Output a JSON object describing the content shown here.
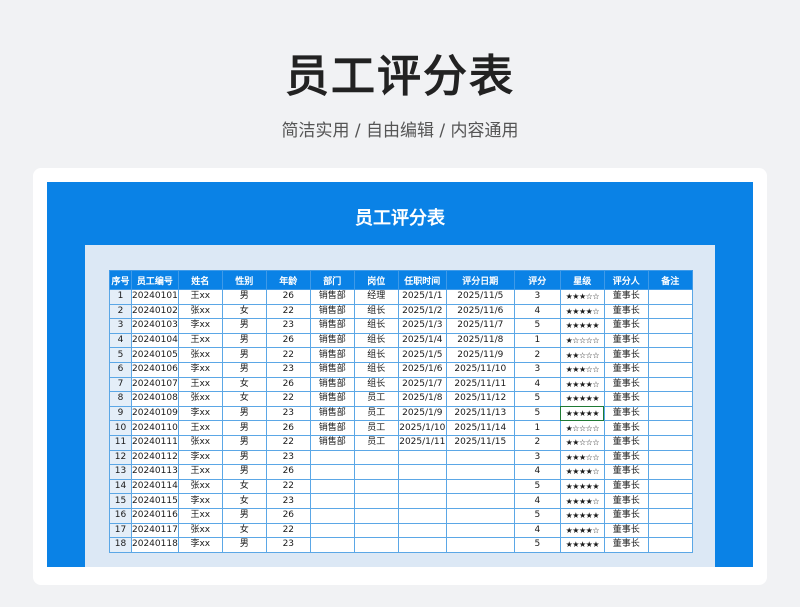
{
  "page": {
    "title": "员工评分表",
    "subtitle": "简洁实用 / 自由编辑 / 内容通用"
  },
  "sheet": {
    "title": "员工评分表",
    "columns": [
      "序号",
      "员工编号",
      "姓名",
      "性别",
      "年龄",
      "部门",
      "岗位",
      "任职时间",
      "评分日期",
      "评分",
      "星级",
      "评分人",
      "备注"
    ],
    "rows": [
      [
        "1",
        "20240101",
        "王xx",
        "男",
        "26",
        "销售部",
        "经理",
        "2025/1/1",
        "2025/11/5",
        "3",
        "★★★☆☆",
        "董事长",
        ""
      ],
      [
        "2",
        "20240102",
        "张xx",
        "女",
        "22",
        "销售部",
        "组长",
        "2025/1/2",
        "2025/11/6",
        "4",
        "★★★★☆",
        "董事长",
        ""
      ],
      [
        "3",
        "20240103",
        "李xx",
        "男",
        "23",
        "销售部",
        "组长",
        "2025/1/3",
        "2025/11/7",
        "5",
        "★★★★★",
        "董事长",
        ""
      ],
      [
        "4",
        "20240104",
        "王xx",
        "男",
        "26",
        "销售部",
        "组长",
        "2025/1/4",
        "2025/11/8",
        "1",
        "★☆☆☆☆",
        "董事长",
        ""
      ],
      [
        "5",
        "20240105",
        "张xx",
        "男",
        "22",
        "销售部",
        "组长",
        "2025/1/5",
        "2025/11/9",
        "2",
        "★★☆☆☆",
        "董事长",
        ""
      ],
      [
        "6",
        "20240106",
        "李xx",
        "男",
        "23",
        "销售部",
        "组长",
        "2025/1/6",
        "2025/11/10",
        "3",
        "★★★☆☆",
        "董事长",
        ""
      ],
      [
        "7",
        "20240107",
        "王xx",
        "女",
        "26",
        "销售部",
        "组长",
        "2025/1/7",
        "2025/11/11",
        "4",
        "★★★★☆",
        "董事长",
        ""
      ],
      [
        "8",
        "20240108",
        "张xx",
        "女",
        "22",
        "销售部",
        "员工",
        "2025/1/8",
        "2025/11/12",
        "5",
        "★★★★★",
        "董事长",
        ""
      ],
      [
        "9",
        "20240109",
        "李xx",
        "男",
        "23",
        "销售部",
        "员工",
        "2025/1/9",
        "2025/11/13",
        "5",
        "★★★★★",
        "董事长",
        ""
      ],
      [
        "10",
        "20240110",
        "王xx",
        "男",
        "26",
        "销售部",
        "员工",
        "2025/1/10",
        "2025/11/14",
        "1",
        "★☆☆☆☆",
        "董事长",
        ""
      ],
      [
        "11",
        "20240111",
        "张xx",
        "男",
        "22",
        "销售部",
        "员工",
        "2025/1/11",
        "2025/11/15",
        "2",
        "★★☆☆☆",
        "董事长",
        ""
      ],
      [
        "12",
        "20240112",
        "李xx",
        "男",
        "23",
        "",
        "",
        "",
        "",
        "3",
        "★★★☆☆",
        "董事长",
        ""
      ],
      [
        "13",
        "20240113",
        "王xx",
        "男",
        "26",
        "",
        "",
        "",
        "",
        "4",
        "★★★★☆",
        "董事长",
        ""
      ],
      [
        "14",
        "20240114",
        "张xx",
        "女",
        "22",
        "",
        "",
        "",
        "",
        "5",
        "★★★★★",
        "董事长",
        ""
      ],
      [
        "15",
        "20240115",
        "李xx",
        "女",
        "23",
        "",
        "",
        "",
        "",
        "4",
        "★★★★☆",
        "董事长",
        ""
      ],
      [
        "16",
        "20240116",
        "王xx",
        "男",
        "26",
        "",
        "",
        "",
        "",
        "5",
        "★★★★★",
        "董事长",
        ""
      ],
      [
        "17",
        "20240117",
        "张xx",
        "女",
        "22",
        "",
        "",
        "",
        "",
        "4",
        "★★★★☆",
        "董事长",
        ""
      ],
      [
        "18",
        "20240118",
        "李xx",
        "男",
        "23",
        "",
        "",
        "",
        "",
        "5",
        "★★★★★",
        "董事长",
        ""
      ]
    ]
  }
}
